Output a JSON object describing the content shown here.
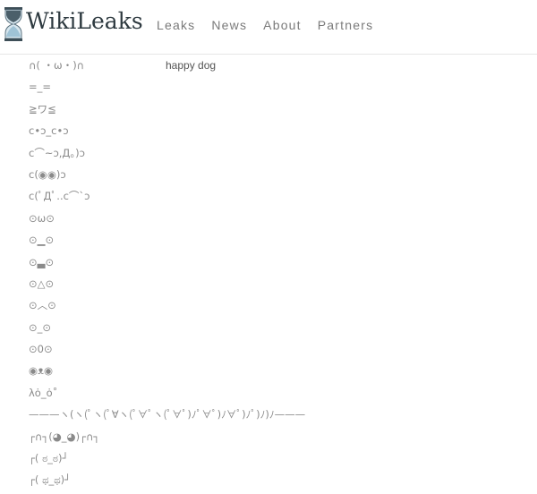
{
  "header": {
    "brand": "WikiLeaks",
    "logo_icon": "hourglass-icon",
    "nav": [
      {
        "label": "Leaks"
      },
      {
        "label": "News"
      },
      {
        "label": "About"
      },
      {
        "label": "Partners"
      }
    ]
  },
  "emoticons": [
    {
      "face": "∩( ・ω・)∩",
      "desc": "happy dog"
    },
    {
      "face": "=_=",
      "desc": ""
    },
    {
      "face": "≧ワ≦",
      "desc": ""
    },
    {
      "face": "c•ɔ_c•ɔ",
      "desc": ""
    },
    {
      "face": "c⌒~ɔ,Д。)ɔ",
      "desc": ""
    },
    {
      "face": "c(◉◉)ɔ",
      "desc": ""
    },
    {
      "face": "c(ﾟДﾟ..c⌒ˋɔ",
      "desc": ""
    },
    {
      "face": "⊙ω⊙",
      "desc": ""
    },
    {
      "face": "⊙▁⊙",
      "desc": ""
    },
    {
      "face": "⊙▃⊙",
      "desc": ""
    },
    {
      "face": "⊙△⊙",
      "desc": ""
    },
    {
      "face": "⊙︿⊙",
      "desc": ""
    },
    {
      "face": "⊙_⊙",
      "desc": ""
    },
    {
      "face": "⊙0⊙",
      "desc": ""
    },
    {
      "face": "◉ᴥ◉",
      "desc": ""
    },
    {
      "face": "λȯ_ȯ˚",
      "desc": ""
    },
    {
      "face": "———ヽ(ヽ(ﾟヽ(ﾟ∀ヽ(ﾟ∀ﾟヽ(ﾟ∀ﾟ)ﾉﾟ∀ﾟ)ﾉ∀ﾟ)ﾉﾟ)ﾉ)ﾉ———",
      "desc": ""
    },
    {
      "face": "┌∩┐(◕_◕)┌∩┐",
      "desc": ""
    },
    {
      "face": "┌( ಠ_ಠ)┘",
      "desc": ""
    },
    {
      "face": "┌( ಥ_ಥ)┘",
      "desc": ""
    }
  ]
}
